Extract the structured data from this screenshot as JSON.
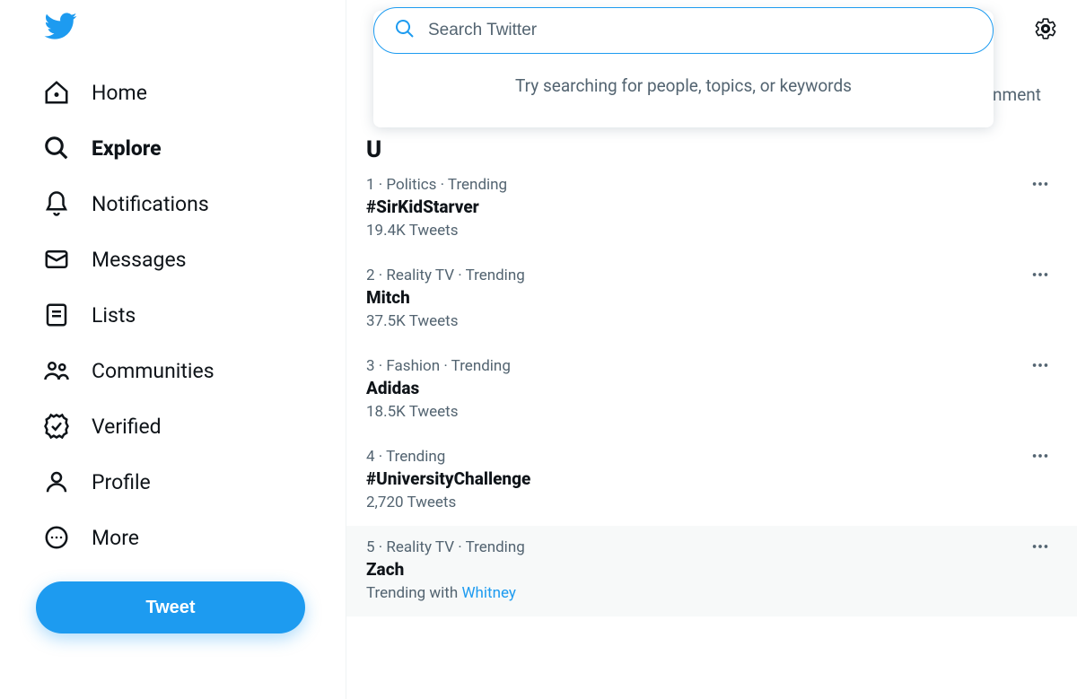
{
  "sidebar": {
    "items": [
      {
        "label": "Home"
      },
      {
        "label": "Explore"
      },
      {
        "label": "Notifications"
      },
      {
        "label": "Messages"
      },
      {
        "label": "Lists"
      },
      {
        "label": "Communities"
      },
      {
        "label": "Verified"
      },
      {
        "label": "Profile"
      },
      {
        "label": "More"
      }
    ],
    "tweet_button": "Tweet"
  },
  "search": {
    "placeholder": "Search Twitter",
    "dropdown_hint": "Try searching for people, topics, or keywords"
  },
  "tab_fragment": "nment",
  "heading_fragment": "U",
  "trends": [
    {
      "meta": "1 · Politics · Trending",
      "title": "#SirKidStarver",
      "sub": "19.4K Tweets",
      "link": ""
    },
    {
      "meta": "2 · Reality TV · Trending",
      "title": "Mitch",
      "sub": "37.5K Tweets",
      "link": ""
    },
    {
      "meta": "3 · Fashion · Trending",
      "title": "Adidas",
      "sub": "18.5K Tweets",
      "link": ""
    },
    {
      "meta": "4 · Trending",
      "title": "#UniversityChallenge",
      "sub": "2,720 Tweets",
      "link": ""
    },
    {
      "meta": "5 · Reality TV · Trending",
      "title": "Zach",
      "sub": "Trending with ",
      "link": "Whitney"
    }
  ]
}
